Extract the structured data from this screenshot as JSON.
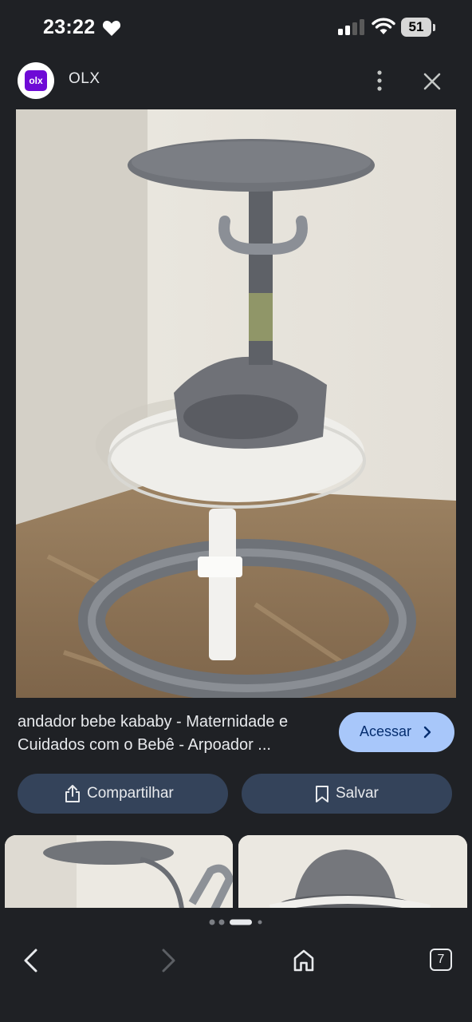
{
  "status_bar": {
    "time": "23:22",
    "battery": "51"
  },
  "header": {
    "site_name": "OLX",
    "logo_text": "olx"
  },
  "result": {
    "caption": "andador bebe kababy - Maternidade e Cuidados com o Bebê - Arpoador ...",
    "visit_button": "Acessar"
  },
  "actions": {
    "share_label": "Compartilhar",
    "save_label": "Salvar"
  },
  "pager": {
    "dot_count": 4,
    "active_index": 2
  },
  "bottom_nav": {
    "tab_count": "7"
  },
  "colors": {
    "background": "#1f2125",
    "accent": "#a8c7fa",
    "pill": "#34435a",
    "olx_purple": "#6e0ad6"
  }
}
